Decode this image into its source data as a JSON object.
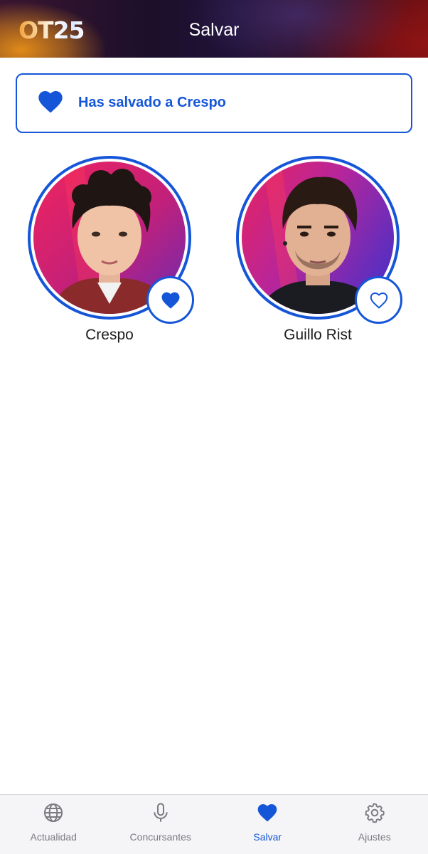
{
  "header": {
    "logo_text": "OT25",
    "title": "Salvar"
  },
  "banner": {
    "icon": "heart-filled-icon",
    "message": "Has salvado a Crespo"
  },
  "contestants": [
    {
      "name": "Crespo",
      "saved": true,
      "heart_icon": "heart-filled-icon"
    },
    {
      "name": "Guillo Rist",
      "saved": false,
      "heart_icon": "heart-outline-icon"
    }
  ],
  "tabbar": {
    "items": [
      {
        "label": "Actualidad",
        "icon": "globe-icon",
        "active": false
      },
      {
        "label": "Concursantes",
        "icon": "microphone-icon",
        "active": false
      },
      {
        "label": "Salvar",
        "icon": "heart-filled-icon",
        "active": true
      },
      {
        "label": "Ajustes",
        "icon": "gear-icon",
        "active": false
      }
    ]
  },
  "colors": {
    "accent": "#1556d8",
    "inactive": "#7b7b80",
    "tabbar_bg": "#f5f5f7"
  }
}
